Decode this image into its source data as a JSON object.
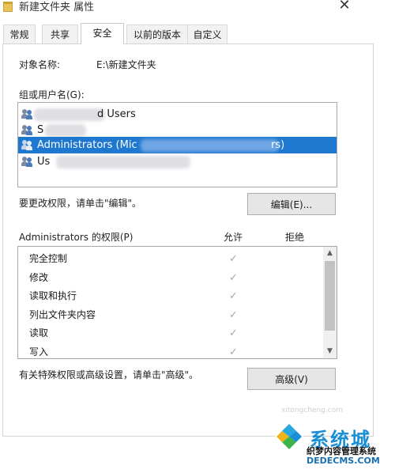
{
  "window": {
    "title": "新建文件夹 属性"
  },
  "tabs": [
    {
      "label": "常规",
      "active": false
    },
    {
      "label": "共享",
      "active": false
    },
    {
      "label": "安全",
      "active": true
    },
    {
      "label": "以前的版本",
      "active": false
    },
    {
      "label": "自定义",
      "active": false
    }
  ],
  "object": {
    "label": "对象名称:",
    "value": "E:\\新建文件夹"
  },
  "groups": {
    "label": "组或用户名(G):",
    "users": [
      {
        "text": "d Users",
        "selected": false
      },
      {
        "text": "S",
        "selected": false
      },
      {
        "text": "Administrators (Mic",
        "text_tail": "rs)",
        "selected": true
      },
      {
        "text": "Us",
        "selected": false
      }
    ]
  },
  "edit": {
    "hint": "要更改权限，请单击\"编辑\"。",
    "button": "编辑(E)..."
  },
  "permissions": {
    "title": "Administrators 的权限(P)",
    "allow_header": "允许",
    "deny_header": "拒绝",
    "check_glyph": "✓",
    "rows": [
      {
        "name": "完全控制"
      },
      {
        "name": "修改"
      },
      {
        "name": "读取和执行"
      },
      {
        "name": "列出文件夹内容"
      },
      {
        "name": "读取"
      },
      {
        "name": "写入"
      }
    ]
  },
  "advanced": {
    "hint": "有关特殊权限或高级设置，请单击\"高级\"。",
    "button": "高级(V)"
  },
  "watermark": {
    "faint": "xitongcheng.com",
    "brand": "系统城",
    "line1": "织梦内容管理系统",
    "line2": "DEDECMS.COM"
  },
  "colors": {
    "selection": "#1e78d0",
    "watermark_blue": "#1a8fd6"
  }
}
